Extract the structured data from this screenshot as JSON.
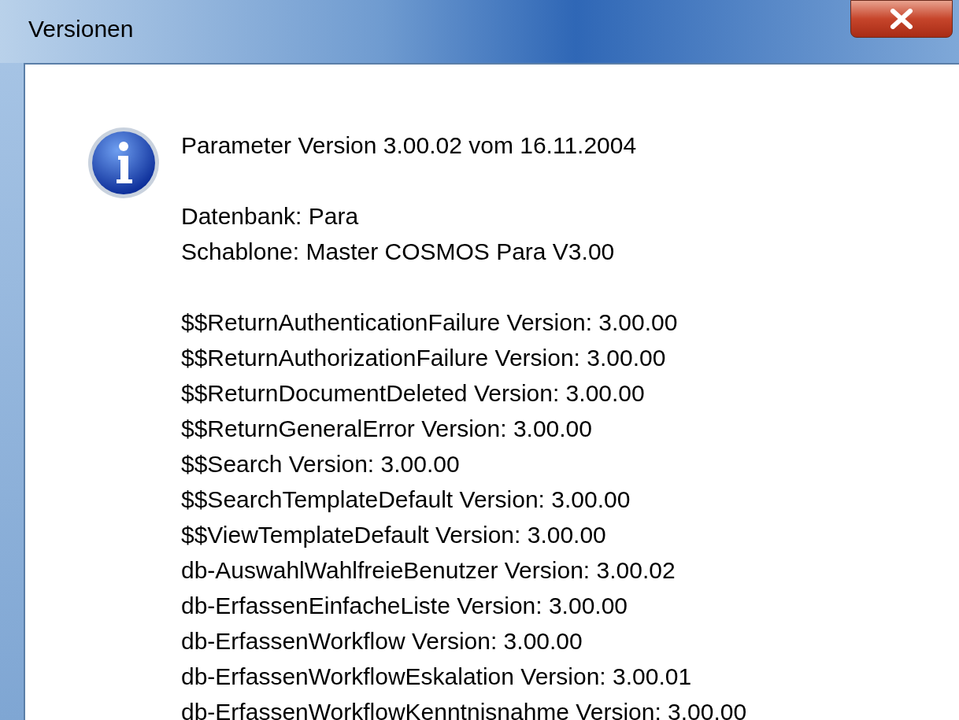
{
  "window": {
    "title": "Versionen"
  },
  "message": {
    "heading": "Parameter Version 3.00.02 vom 16.11.2004",
    "details": [
      "Datenbank: Para",
      "Schablone: Master COSMOS Para V3.00"
    ],
    "versions": [
      "$$ReturnAuthenticationFailure Version: 3.00.00",
      "$$ReturnAuthorizationFailure Version: 3.00.00",
      "$$ReturnDocumentDeleted Version: 3.00.00",
      "$$ReturnGeneralError Version: 3.00.00",
      "$$Search Version: 3.00.00",
      "$$SearchTemplateDefault Version: 3.00.00",
      "$$ViewTemplateDefault Version: 3.00.00",
      "db-AuswahlWahlfreieBenutzer Version: 3.00.02",
      "db-ErfassenEinfacheListe Version: 3.00.00",
      "db-ErfassenWorkflow Version: 3.00.00",
      "db-ErfassenWorkflowEskalation Version: 3.00.01",
      "db-ErfassenWorkflowKenntnisnahme Version: 3.00.00"
    ]
  }
}
